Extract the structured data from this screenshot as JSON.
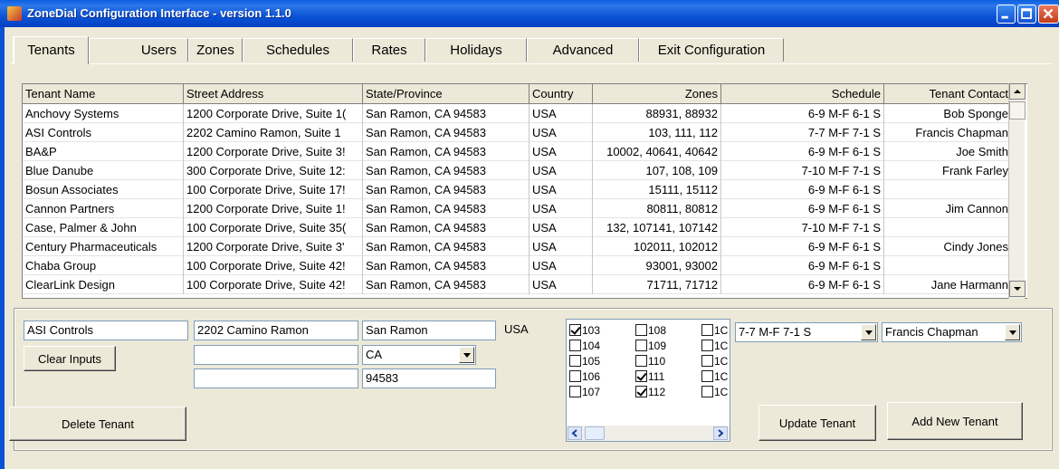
{
  "window": {
    "title": "ZoneDial Configuration Interface - version 1.1.0"
  },
  "tabs": [
    {
      "label": "Tenants",
      "active": true
    },
    {
      "label": "Users"
    },
    {
      "label": "Zones"
    },
    {
      "label": "Schedules"
    },
    {
      "label": "Rates"
    },
    {
      "label": "Holidays"
    },
    {
      "label": "Advanced"
    },
    {
      "label": "Exit Configuration"
    }
  ],
  "table": {
    "columns": [
      "Tenant Name",
      "Street Address",
      "State/Province",
      "Country",
      "Zones",
      "Schedule",
      "Tenant Contact"
    ],
    "rows": [
      [
        "Anchovy Systems",
        "1200 Corporate Drive, Suite 1(",
        "San Ramon, CA  94583",
        "USA",
        "88931, 88932",
        "6-9 M-F 6-1 S",
        "Bob Sponge"
      ],
      [
        "ASI Controls",
        "2202 Camino Ramon, Suite 1",
        "San Ramon, CA  94583",
        "USA",
        "103, 111, 112",
        "7-7 M-F 7-1 S",
        "Francis Chapman"
      ],
      [
        "BA&P",
        "1200 Corporate Drive, Suite 3!",
        "San Ramon, CA  94583",
        "USA",
        "10002, 40641, 40642",
        "6-9 M-F 6-1 S",
        "Joe Smith"
      ],
      [
        "Blue Danube",
        "300 Corporate Drive, Suite 12:",
        "San Ramon, CA  94583",
        "USA",
        "107, 108, 109",
        "7-10 M-F 7-1 S",
        "Frank Farley"
      ],
      [
        "Bosun Associates",
        "100 Corporate Drive, Suite 17!",
        "San Ramon, CA  94583",
        "USA",
        "15111, 15112",
        "6-9 M-F 6-1 S",
        ""
      ],
      [
        "Cannon Partners",
        "1200 Corporate Drive, Suite 1!",
        "San Ramon, CA  94583",
        "USA",
        "80811, 80812",
        "6-9 M-F 6-1 S",
        "Jim Cannon"
      ],
      [
        "Case, Palmer & John",
        "100 Corporate Drive, Suite 35(",
        "San Ramon, CA  94583",
        "USA",
        "132, 107141, 107142",
        "7-10 M-F 7-1 S",
        ""
      ],
      [
        "Century Pharmaceuticals",
        "1200 Corporate Drive, Suite 3'",
        "San Ramon, CA  94583",
        "USA",
        "102011, 102012",
        "6-9 M-F 6-1 S",
        "Cindy Jones"
      ],
      [
        "Chaba Group",
        "100 Corporate Drive, Suite 42!",
        "San Ramon, CA  94583",
        "USA",
        "93001, 93002",
        "6-9 M-F 6-1 S",
        ""
      ],
      [
        "ClearLink Design",
        "100 Corporate Drive, Suite 42!",
        "San Ramon, CA  94583",
        "USA",
        "71711, 71712",
        "6-9 M-F 6-1 S",
        "Jane Harmann"
      ]
    ]
  },
  "form": {
    "tenant_name": "ASI Controls",
    "street1": "2202 Camino Ramon",
    "street2": "",
    "street3": "",
    "city": "San Ramon",
    "country": "USA",
    "state": "CA",
    "zip": "94583",
    "schedule": "7-7 M-F 7-1 S",
    "contact": "Francis Chapman",
    "clear_label": "Clear Inputs",
    "delete_label": "Delete Tenant",
    "update_label": "Update Tenant",
    "add_label": "Add New Tenant"
  },
  "zones": [
    {
      "label": "103",
      "checked": true
    },
    {
      "label": "104",
      "checked": false
    },
    {
      "label": "105",
      "checked": false
    },
    {
      "label": "106",
      "checked": false
    },
    {
      "label": "107",
      "checked": false
    },
    {
      "label": "108",
      "checked": false
    },
    {
      "label": "109",
      "checked": false
    },
    {
      "label": "110",
      "checked": false
    },
    {
      "label": "111",
      "checked": true
    },
    {
      "label": "112",
      "checked": true
    },
    {
      "label": "1C",
      "checked": false
    },
    {
      "label": "1C",
      "checked": false
    },
    {
      "label": "1C",
      "checked": false
    },
    {
      "label": "1C",
      "checked": false
    },
    {
      "label": "1C",
      "checked": false
    }
  ]
}
